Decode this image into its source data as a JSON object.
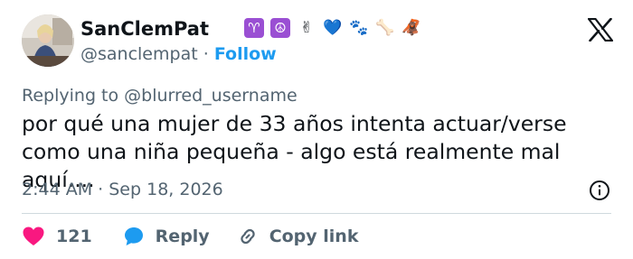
{
  "tweet": {
    "display_name": "SanClemPat",
    "name_emojis": [
      {
        "icon": "aries-icon",
        "glyph": "♈",
        "style": "badge"
      },
      {
        "icon": "peace-icon",
        "glyph": "☮",
        "style": "badge"
      },
      {
        "icon": "victory-hand-icon",
        "glyph": "✌",
        "style": "plain"
      },
      {
        "icon": "blue-heart-icon",
        "glyph": "💙",
        "style": "plain"
      },
      {
        "icon": "paw-prints-icon",
        "glyph": "🐾",
        "style": "plain"
      },
      {
        "icon": "bone-icon",
        "glyph": "🦴",
        "style": "plain"
      },
      {
        "icon": "orangutan-icon",
        "glyph": "🦧",
        "style": "plain"
      }
    ],
    "handle": "@sanclempat",
    "separator": "·",
    "follow_label": "Follow",
    "replying_prefix": "Replying to",
    "replying_to": "@blurred_username",
    "text": "por qué una mujer de 33 años intenta actuar/verse como una niña pequeña - algo está realmente mal aquí....",
    "time": "2:44 AM",
    "meta_separator": "·",
    "date": "Sep 18, 2026"
  },
  "actions": {
    "like_count": "121",
    "reply_label": "Reply",
    "copy_link_label": "Copy link"
  },
  "colors": {
    "accent": "#1d9bf0",
    "like": "#f91880",
    "text": "#0f1419",
    "secondary": "#536471",
    "divider": "#cfd9de"
  }
}
